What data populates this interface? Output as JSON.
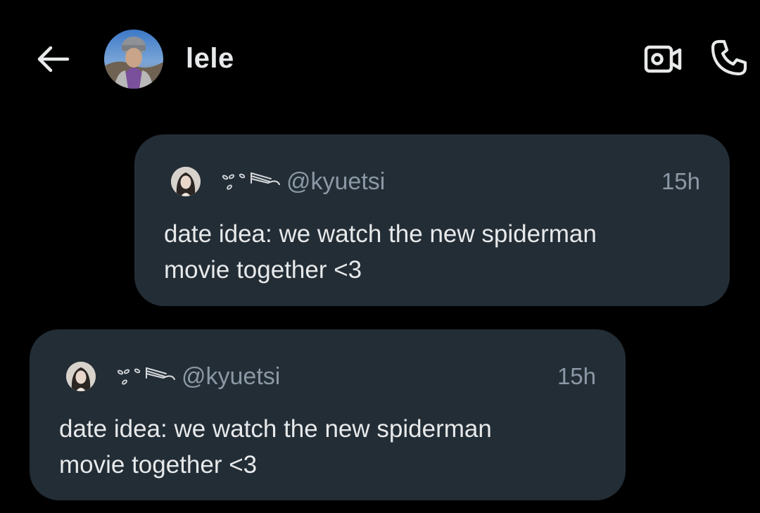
{
  "header": {
    "back_icon": "arrow-left-icon",
    "contact_name": "lele",
    "video_icon": "video-camera-icon",
    "call_icon": "phone-icon"
  },
  "messages": [
    {
      "direction": "sent",
      "tweet": {
        "handle": "@kyuetsi",
        "time": "15h",
        "text": "date idea: we watch the new spiderman movie together <3"
      }
    },
    {
      "direction": "received",
      "tweet": {
        "handle": "@kyuetsi",
        "time": "15h",
        "text": "date idea: we watch the new spiderman movie together <3"
      }
    }
  ],
  "colors": {
    "background": "#000000",
    "bubble": "#232d36",
    "primary_text": "#e7e9ea",
    "secondary_text": "#8b98a5"
  }
}
